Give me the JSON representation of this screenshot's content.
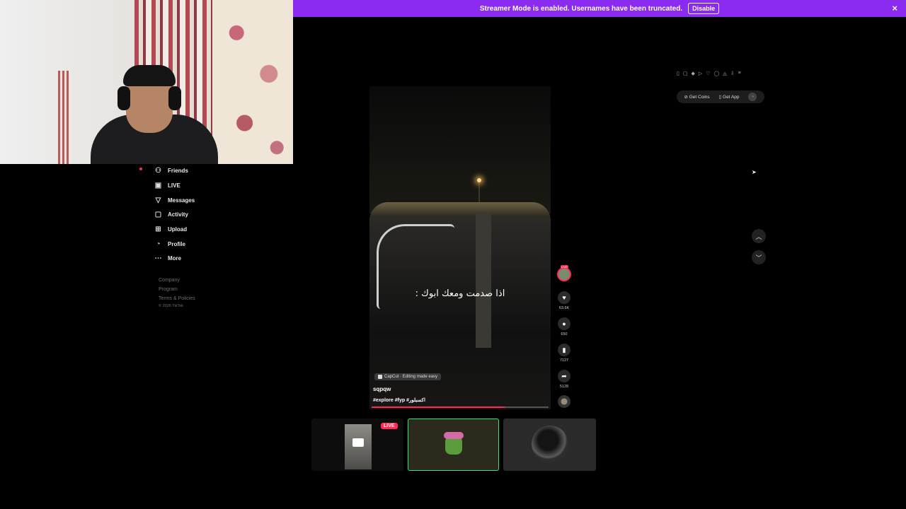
{
  "banner": {
    "message": "Streamer Mode is enabled. Usernames have been truncated.",
    "disable_label": "Disable",
    "close_icon": "×"
  },
  "sidebar": {
    "items": [
      {
        "label": "Friends",
        "icon": "friends-icon",
        "glyph": "👥"
      },
      {
        "label": "LIVE",
        "icon": "live-icon",
        "glyph": "▣"
      },
      {
        "label": "Messages",
        "icon": "messages-icon",
        "glyph": "▽"
      },
      {
        "label": "Activity",
        "icon": "activity-icon",
        "glyph": "▢"
      },
      {
        "label": "Upload",
        "icon": "upload-icon",
        "glyph": "⊞"
      },
      {
        "label": "Profile",
        "icon": "profile-icon",
        "glyph": "◔"
      },
      {
        "label": "More",
        "icon": "more-icon",
        "glyph": "···"
      }
    ],
    "footer": {
      "company": "Company",
      "program": "Program",
      "terms": "Terms & Policies",
      "copyright": "© 2026 TikTok"
    }
  },
  "header": {
    "get_coins": "Get Coins",
    "get_app": "Get App"
  },
  "video": {
    "caption": "اذا صدمت ومعك ابوك :",
    "capcut_label": "CapCut · Editing made easy",
    "username": "sqpqw",
    "tags": "#explore #fyp #اكسبلور",
    "progress": 0.75
  },
  "actions": {
    "live_badge": "LIVE",
    "likes": "63.6K",
    "comments": "650",
    "saves": "7127",
    "shares": "5128"
  },
  "thumbnails": {
    "live_tag": "LIVE"
  },
  "colors": {
    "banner": "#8c2bf0",
    "accent": "#fe2c55",
    "selected_border": "#3fe07d"
  }
}
